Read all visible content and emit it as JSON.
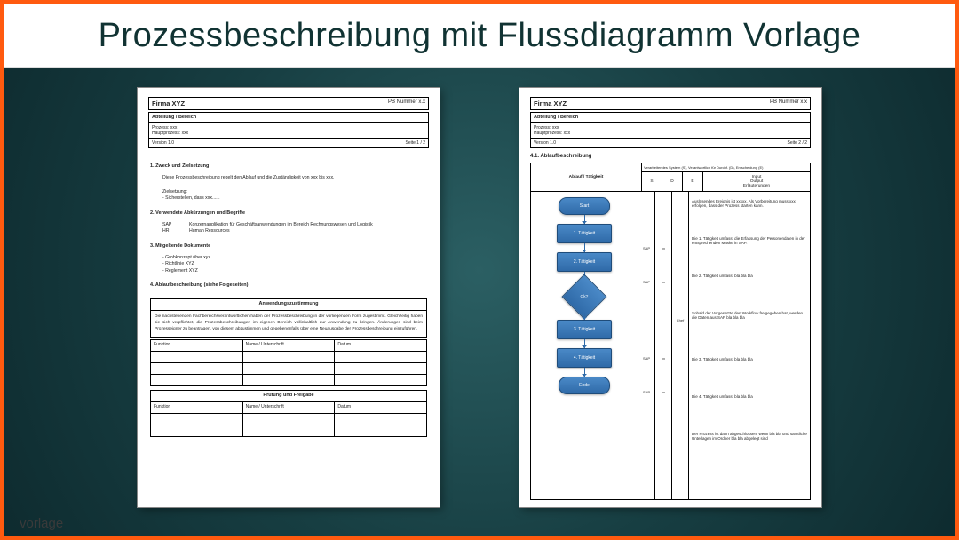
{
  "title": "Prozessbeschreibung mit Flussdiagramm Vorlage",
  "watermark": "vorlage",
  "header": {
    "company": "Firma XYZ",
    "pb": "PB Nummer x.x",
    "dept": "Abteilung / Bereich",
    "process": "Prozess: xxx",
    "main_process": "Hauptprozess: xxx",
    "version": "Version 1.0",
    "page1": "Seite 1 / 2",
    "page2": "Seite 2 / 2"
  },
  "p1": {
    "h1": "1. Zweck und Zielsetzung",
    "t1": "Diese Prozessbeschreibung regelt den Ablauf und die Zuständigkeit von xxx bis xxx.",
    "t1a": "Zielsetzung:",
    "t1b": "- Sicherstellen, dass xxx......",
    "h2": "2. Verwendete Abkürzungen und Begriffe",
    "abbr_sap": "SAP",
    "abbr_sap_t": "Konzernapplikation für Geschäftsanwendungen im Bereich Rechnungswesen und Logistik",
    "abbr_hr": "HR",
    "abbr_hr_t": "Human Ressources",
    "h3": "3. Mitgeltende Dokumente",
    "d1": "- Grobkonzept über xyz",
    "d2": "- Richtlinie XYZ",
    "d3": "- Reglement XYZ",
    "h4": "4. Ablaufbeschreibung (siehe Folgeseiten)",
    "approve_title": "Anwendungszustimmung",
    "approve_text": "Die nachstehenden Fachbereichsverantwortlichen haben der Prozessbeschreibung in der vorliegenden Form zugestimmt. Gleichzeitig haben sie sich verpflichtet, die Prozessbeschreibungen im eigenen Bereich vollinhaltlich zur Anwendung zu bringen. Änderungen sind beim Prozesseigner zu beantragen, von diesem abzustimmen und gegebenenfalls über eine Neuausgabe der Prozessbeschreibung einzuführen.",
    "sig_h1": "Funktion",
    "sig_h2": "Name / Unterschrift",
    "sig_h3": "Datum",
    "check_title": "Prüfung und Freigabe"
  },
  "p2": {
    "h": "4.1. Ablaufbeschreibung",
    "legend": "Verarbeitendes System (S), Verantwortlich für Durchf. (D), Entscheidung (E)",
    "col_act": "Ablauf / Tätigkeit",
    "col_s": "S",
    "col_d": "D",
    "col_e": "E",
    "col_io": "Input\nOutput\nErläuterungen",
    "steps": {
      "start": "Start",
      "t1": "1. Tätigkeit",
      "t2": "2. Tätigkeit",
      "dec": "Ok?",
      "t3": "3. Tätigkeit",
      "t4": "4. Tätigkeit",
      "end": "Ende"
    },
    "io": {
      "r0": "Auslösendes Ereignis ist xxxxx. Als Vorbereitung muss xxx erfolgen, dass der Prozess starten kann.",
      "r1": "Die 1. Tätigkeit umfasst die Erfassung der Personendaten in der entsprechenden Maske in SAP.",
      "r2": "Die 2. Tätigkeit umfasst bla bla bla",
      "r3": "Sobald der Vorgesetzte den Workflow freigegeben hat, werden die Daten aus SAP bla bla bla",
      "r4": "Die 3. Tätigkeit umfasst bla bla bla",
      "r5": "Die 4. Tätigkeit umfasst bla bla bla",
      "r6": "Der Prozess ist dann abgeschlossen, wenn bla bla und sämtliche Unterlagen im Ordner bla bla abgelegt sind"
    },
    "marks": {
      "sap": "SAP",
      "xx": "xx",
      "chef": "Chef"
    }
  }
}
